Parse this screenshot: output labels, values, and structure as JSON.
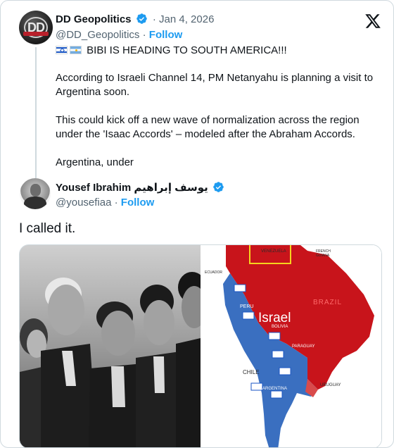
{
  "quoted_tweet": {
    "author_name": "DD Geopolitics",
    "avatar_text": "DD",
    "date": "Jan 4, 2026",
    "handle": "@DD_Geopolitics",
    "separator": "·",
    "follow_label": "Follow",
    "flags": [
      "israel-flag-icon",
      "argentina-flag-icon"
    ],
    "headline": "BIBI IS HEADING TO SOUTH AMERICA!!!",
    "paragraph_1": "According to Israeli Channel 14, PM Netanyahu is planning a visit to Argentina soon.",
    "paragraph_2": "This could kick off a new wave of normalization across the region under the 'Isaac Accords' – modeled after the Abraham Accords.",
    "paragraph_3": "Argentina, under"
  },
  "tweet": {
    "author_name": "Yousef Ibrahim",
    "author_name_arabic": "يوسف إبراهيم",
    "handle": "@yousefiaa",
    "separator": "·",
    "follow_label": "Follow",
    "text": "I called it."
  },
  "media": {
    "left_image": "black-and-white photo of five men in suits standing in profile",
    "right_image": {
      "type": "map of South America",
      "labels": {
        "venezuela": "VENEZUELA",
        "french_guiana": "FRENCH GUIANA",
        "ecuador": "ECUADOR",
        "peru": "PERU",
        "brazil": "BRAZIL",
        "israel": "Israel",
        "bolivia": "BOLIVIA",
        "paraguay": "PARAGUAY",
        "chile": "CHILE",
        "argentina": "ARGENTINA",
        "uruguay": "URUGUAY"
      }
    }
  },
  "colors": {
    "accent": "#1d9bf0",
    "text": "#0f1419",
    "muted": "#536471",
    "border": "#cfd9de",
    "map_red": "#c8141b",
    "map_blue": "#3a6fc0"
  }
}
